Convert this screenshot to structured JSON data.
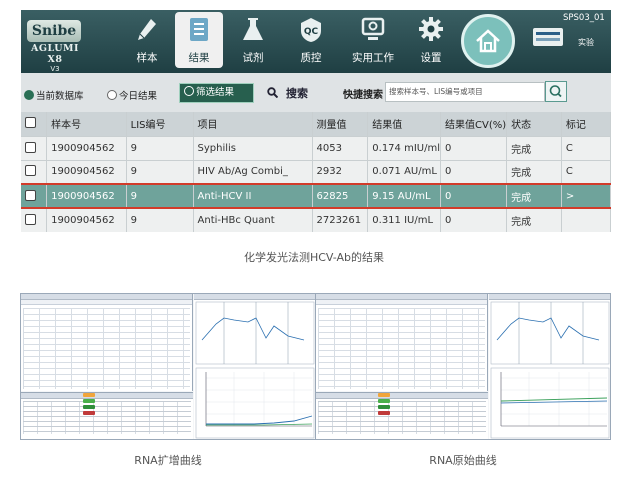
{
  "brand": {
    "logo": "Snibe",
    "product": "AGLUMI X8",
    "version": "V3"
  },
  "nav": [
    {
      "label": "样本",
      "icon": "pen-icon"
    },
    {
      "label": "结果",
      "icon": "document-list-icon"
    },
    {
      "label": "试剂",
      "icon": "flask-icon"
    },
    {
      "label": "质控",
      "icon": "qc-icon"
    },
    {
      "label": "实用工作",
      "icon": "monitor-tool-icon"
    },
    {
      "label": "设置",
      "icon": "gear-icon"
    }
  ],
  "home_icon": "home-icon",
  "station": {
    "id": "SPS03_01",
    "mode": "实验"
  },
  "filters": {
    "current_db": "当前数据库",
    "today": "今日结果",
    "filter": "筛选结果",
    "search": "搜索",
    "quick_label": "快捷搜索",
    "quick_placeholder": "搜索样本号、LIS编号或项目"
  },
  "table": {
    "columns": [
      "样本号",
      "LIS编号",
      "项目",
      "测量值",
      "结果值",
      "结果值CV(%)",
      "状态",
      "标记"
    ],
    "rows": [
      [
        "1900904562",
        "9",
        "Syphilis",
        "4053",
        "0.174 mIU/ml",
        "0",
        "完成",
        "C"
      ],
      [
        "1900904562",
        "9",
        "HIV Ab/Ag Combi_",
        "2932",
        "0.071 AU/mL",
        "0",
        "完成",
        "C"
      ],
      [
        "1900904562",
        "9",
        "Anti-HCV II",
        "62825",
        "9.15 AU/mL",
        "0",
        "完成",
        ">"
      ],
      [
        "1900904562",
        "9",
        "Anti-HBc Quant",
        "2723261",
        "0.311 IU/mL",
        "0",
        "完成",
        ""
      ]
    ],
    "highlighted_row": 2
  },
  "captions": {
    "top": "化学发光法测HCV-Ab的结果",
    "left": "RNA扩增曲线",
    "right": "RNA原始曲线"
  },
  "colors": {
    "header_bg": "#2d4f53",
    "highlight_row": "#6fa39b",
    "highlight_border": "#d23b2a",
    "accent": "#275f4e"
  }
}
